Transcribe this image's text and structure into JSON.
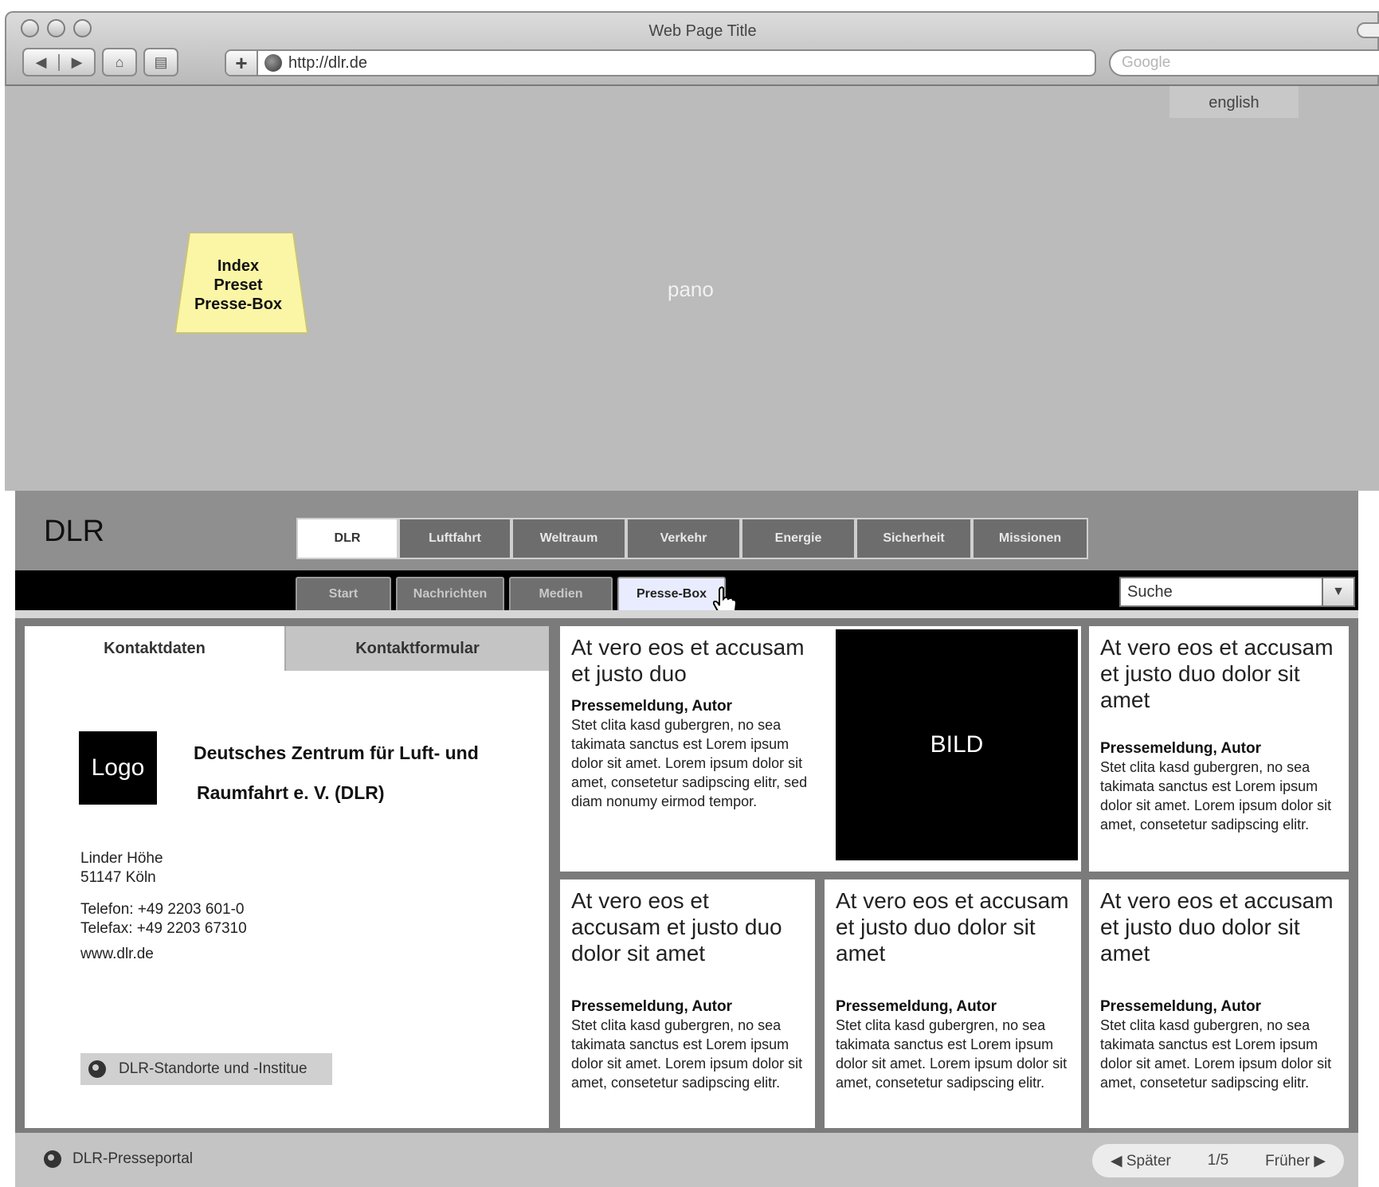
{
  "browser": {
    "window_title": "Web Page Title",
    "url": "http://dlr.de",
    "search_placeholder": "Google",
    "nav_back": "◀",
    "nav_forward": "▶",
    "home": "⌂",
    "print": "▤",
    "add": "+"
  },
  "pano": {
    "label": "pano",
    "language_button": "english",
    "sticky_note": [
      "Index",
      "Preset",
      "Presse-Box"
    ]
  },
  "site": {
    "logo_text": "DLR",
    "main_tabs": [
      "DLR",
      "Luftfahrt",
      "Weltraum",
      "Verkehr",
      "Energie",
      "Sicherheit",
      "Missionen"
    ],
    "active_main_tab": "DLR",
    "sub_tabs": [
      "Start",
      "Nachrichten",
      "Medien",
      "Presse-Box"
    ],
    "active_sub_tab": "Presse-Box",
    "search_label": "Suche",
    "search_arrow": "▼"
  },
  "contact": {
    "tab_active": "Kontaktdaten",
    "tab_inactive": "Kontaktformular",
    "logo_label": "Logo",
    "org_line1": "Deutsches Zentrum für Luft- und",
    "org_line2": "Raumfahrt e. V. (DLR)",
    "street": "Linder Höhe",
    "city": "51147 Köln",
    "phone": "Telefon: +49 2203 601-0",
    "fax": "Telefax: +49 2203 67310",
    "web": "www.dlr.de",
    "locations_button": "DLR-Standorte und -Institue"
  },
  "featured": {
    "title": "At vero eos et accusam et justo duo",
    "meta": "Pressemeldung, Autor",
    "text": "Stet clita kasd gubergren, no sea takimata sanctus est Lorem ipsum dolor sit amet. Lorem ipsum dolor sit amet, consetetur sadipscing elitr, sed diam nonumy eirmod tempor.",
    "image_label": "BILD"
  },
  "cards": [
    {
      "title": "At vero eos et accusam et justo duo dolor sit amet",
      "meta": "Pressemeldung, Autor",
      "text": "Stet clita kasd gubergren, no sea takimata sanctus est Lorem ipsum dolor sit amet. Lorem ipsum dolor sit amet, consetetur sadipscing elitr."
    },
    {
      "title": "At vero eos et accusam et justo duo dolor sit amet",
      "meta": "Pressemeldung, Autor",
      "text": "Stet clita kasd gubergren, no sea takimata sanctus est Lorem ipsum dolor sit amet. Lorem ipsum dolor sit amet, consetetur sadipscing elitr."
    },
    {
      "title": "At vero eos et accusam et justo duo dolor sit amet",
      "meta": "Pressemeldung, Autor",
      "text": "Stet clita kasd gubergren, no sea takimata sanctus est Lorem ipsum dolor sit amet. Lorem ipsum dolor sit amet, consetetur sadipscing elitr."
    },
    {
      "title": "At vero eos et accusam et justo duo dolor sit amet",
      "meta": "Pressemeldung, Autor",
      "text": "Stet clita kasd gubergren, no sea takimata sanctus est Lorem ipsum dolor sit amet. Lorem ipsum dolor sit amet, consetetur sadipscing elitr."
    }
  ],
  "footer": {
    "portal_link": "DLR-Presseportal",
    "prev_label": "◀  Später",
    "page": "1/5",
    "next_label": "Früher ▶"
  }
}
